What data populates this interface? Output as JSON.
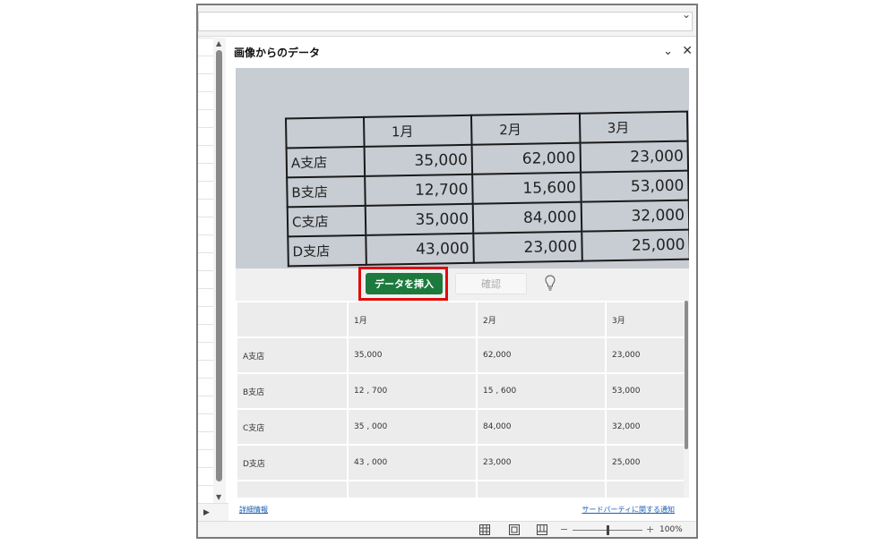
{
  "pane": {
    "title": "画像からのデータ"
  },
  "photo": {
    "header": [
      "",
      "1月",
      "2月",
      "3月"
    ],
    "rows": [
      [
        "A支店",
        "35,000",
        "62,000",
        "23,000"
      ],
      [
        "B支店",
        "12,700",
        "15,600",
        "53,000"
      ],
      [
        "C支店",
        "35,000",
        "84,000",
        "32,000"
      ],
      [
        "D支店",
        "43,000",
        "23,000",
        "25,000"
      ]
    ]
  },
  "actions": {
    "insert_label": "データを挿入",
    "confirm_label": "確認"
  },
  "table": {
    "header": [
      "",
      "1月",
      "2月",
      "3月"
    ],
    "rows": [
      [
        "A支店",
        "35,000",
        "62,000",
        "23,000"
      ],
      [
        "B支店",
        "12 , 700",
        "15 , 600",
        "53,000"
      ],
      [
        "C支店",
        "35 , 000",
        "84,000",
        "32,000"
      ],
      [
        "D支店",
        "43 , 000",
        "23,000",
        "25,000"
      ]
    ]
  },
  "links": {
    "more_info": "詳細情報",
    "third_party": "サードパーティに関する通知"
  },
  "status": {
    "zoom_minus": "−",
    "zoom_plus": "+",
    "zoom_level": "100%",
    "zoom_fraction": 0.5
  },
  "colors": {
    "insert_button": "#1d7a3d",
    "highlight_box": "#e10b0b",
    "link": "#1a5fb4"
  }
}
